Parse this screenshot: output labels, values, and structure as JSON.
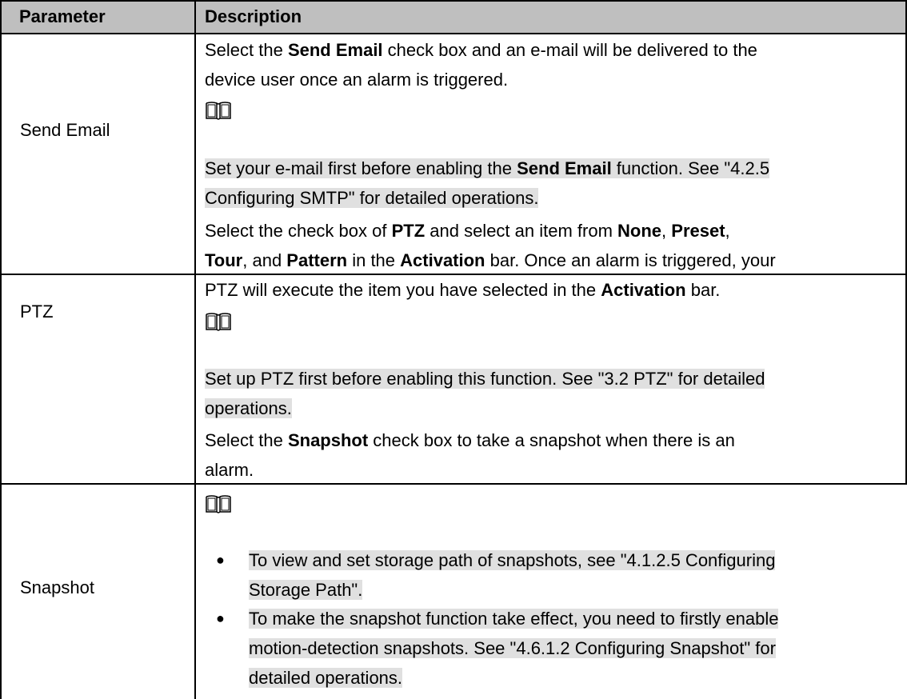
{
  "header": {
    "parameter": "Parameter",
    "description": "Description"
  },
  "rows": [
    {
      "name": "Send Email",
      "desc_l1_a": "Select the ",
      "desc_l1_b": "Send Email",
      "desc_l1_c": " check box and an e-mail will be delivered to the",
      "desc_l2": "device user once an alarm is triggered.",
      "note_l1_a": "Set your e-mail first before enabling the ",
      "note_l1_b": "Send Email",
      "note_l1_c": " function. See \"4.2.5",
      "note_l2": "Configuring SMTP\" for detailed operations."
    },
    {
      "name": "PTZ",
      "l1_a": "Select the check box of ",
      "l1_b": "PTZ",
      "l1_c": " and select an item from ",
      "l1_d": "None",
      "l1_e": ", ",
      "l1_f": "Preset",
      "l1_g": ",",
      "l2_a": "Tour",
      "l2_b": ", and ",
      "l2_c": "Pattern",
      "l2_d": " in the ",
      "l2_e": "Activation",
      "l2_f": " bar. Once an alarm is triggered, your",
      "l3_a": "PTZ will execute the item you have selected in the ",
      "l3_b": "Activation",
      "l3_c": " bar.",
      "note_l1": "Set up PTZ first before enabling this function. See \"3.2 PTZ\" for detailed",
      "note_l2": "operations."
    },
    {
      "name": "Snapshot",
      "l1_a": "Select the ",
      "l1_b": "Snapshot",
      "l1_c": " check box to take a snapshot when there is an",
      "l2": "alarm.",
      "bullet": "●",
      "b1_l1": "To view and set storage path of snapshots, see \"4.1.2.5 Configuring",
      "b1_l2": "Storage Path\".",
      "b2_l1": "To make the snapshot function take effect, you need to firstly enable",
      "b2_l2": "motion-detection snapshots. See \"4.6.1.2 Configuring Snapshot\" for",
      "b2_l3": "detailed operations."
    }
  ],
  "icons": {
    "note": "book-icon"
  }
}
